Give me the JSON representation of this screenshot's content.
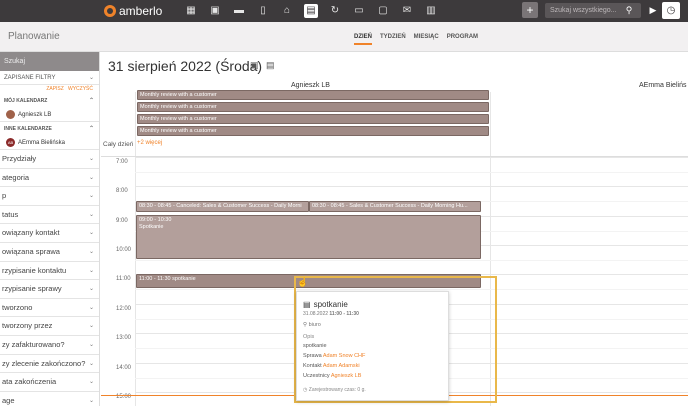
{
  "header": {
    "logo": "amberlo",
    "nav_icons": [
      "dashboard-icon",
      "contacts-icon",
      "briefcase-icon",
      "document-icon",
      "bank-icon",
      "calendar-icon",
      "history-icon",
      "folder-icon",
      "messages-icon",
      "mail-icon",
      "reports-icon"
    ],
    "search_placeholder": "Szukaj wszystkiego...",
    "colors": {
      "bar": "#3d3a3c",
      "accent": "#f0832a"
    }
  },
  "subbar": {
    "module": "Planowanie",
    "views": [
      {
        "label": "DZIEŃ",
        "active": true
      },
      {
        "label": "TYDZIEŃ",
        "active": false
      },
      {
        "label": "MIESIĄC",
        "active": false
      },
      {
        "label": "PROGRAM",
        "active": false
      }
    ]
  },
  "sidebar": {
    "search": "Szukaj",
    "saved_filters": "ZAPISANE FILTRY",
    "save": "ZAPISZ",
    "clear": "WYCZYŚĆ",
    "my_calendar": "MÓJ KALENDARZ",
    "my_person": "Agnieszk LB",
    "other_calendars": "INNE KALENDARZE",
    "other_person": "AEmma Bielińska",
    "other_initials": "AB",
    "filters": [
      "Przydziały",
      "ategoria",
      "p",
      "tatus",
      "owiązany kontakt",
      "owiązana sprawa",
      "rzypisanie kontaktu",
      "rzypisanie sprawy",
      "tworzono",
      "tworzony przez",
      "zy zafakturowano?",
      "zy zlecenie zakończono?",
      "ata zakończenia",
      "age"
    ]
  },
  "calendar": {
    "date_title": "31 sierpień 2022 (Środa)",
    "columns": [
      "Agnieszk LB",
      "AEmma Bielińs"
    ],
    "all_day_label": "Cały dzień",
    "all_day_events": [
      "Monthly review with a customer",
      "Monthly review with a customer",
      "Monthly review with a customer",
      "Monthly review with a customer"
    ],
    "more": "+2 więcej",
    "hours": [
      "7:00",
      "8:00",
      "9:00",
      "10:00",
      "11:00",
      "12:00",
      "13:00",
      "14:00",
      "15:00"
    ],
    "events": [
      {
        "text": "08:30 - 08:45 - Canceled: Sales & Customer Success - Daily Morni"
      },
      {
        "text": "08:30 - 08:45 - Sales & Customer Success - Daily Morning Hu..."
      },
      {
        "time": "09:00 - 10:30",
        "title": "Spotkanie"
      },
      {
        "text": "11:00 - 11:30 spotkanie"
      }
    ]
  },
  "popup": {
    "title": "spotkanie",
    "date": "31.08.2022",
    "time": "11:00 - 11:30",
    "location": "biuro",
    "desc_label": "Opis",
    "desc": "spotkanie",
    "case_label": "Sprawa",
    "case_value": "Adam Snow CHF",
    "contact_label": "Kontakt",
    "contact_value": "Adam Adamski",
    "participants_label": "Uczestnicy",
    "participants_value": "Agnieszk LB",
    "registered": "Zarejestrowany czas: 0 g."
  }
}
